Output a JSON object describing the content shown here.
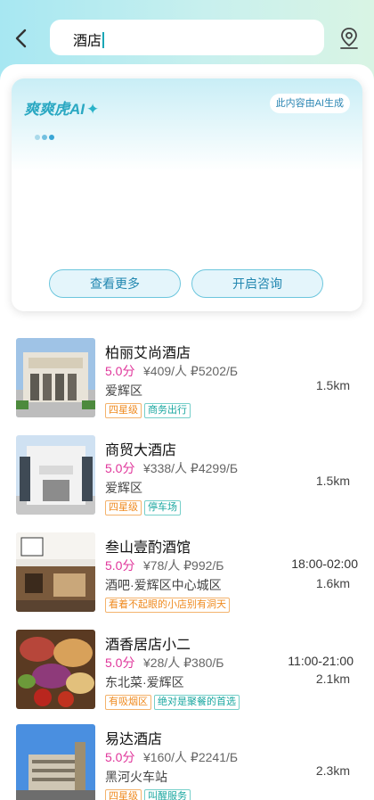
{
  "colors": {
    "accent": "#2aa8c2",
    "score": "#e0369b",
    "tag_orange": "#ef8a1f",
    "tag_teal": "#1aa7a0"
  },
  "header": {
    "search_value": "酒店",
    "back_icon": "chevron-left-icon",
    "location_icon": "location-pin-icon"
  },
  "ai": {
    "title": "爽爽虎AI",
    "spark": "✦",
    "badge": "此内容由AI生成",
    "more_button": "查看更多",
    "consult_button": "开启咨询"
  },
  "results": [
    {
      "name": "柏丽艾尚酒店",
      "score": "5.0分",
      "price": "¥409/人 ₽5202/Б",
      "area": "爱辉区",
      "hours": "",
      "distance": "1.5km",
      "tags": [
        {
          "text": "四星级",
          "color": "orange"
        },
        {
          "text": "商务出行",
          "color": "teal"
        }
      ]
    },
    {
      "name": "商贸大酒店",
      "score": "5.0分",
      "price": "¥338/人 ₽4299/Б",
      "area": "爱辉区",
      "hours": "",
      "distance": "1.5km",
      "tags": [
        {
          "text": "四星级",
          "color": "orange"
        },
        {
          "text": "停车场",
          "color": "teal"
        }
      ]
    },
    {
      "name": "叁山壹酌酒馆",
      "score": "5.0分",
      "price": "¥78/人 ₽992/Б",
      "area": "酒吧·爱辉区中心城区",
      "hours": "18:00-02:00",
      "distance": "1.6km",
      "tags": [
        {
          "text": "看着不起眼的小店别有洞天",
          "color": "orange"
        }
      ]
    },
    {
      "name": "酒香居店小二",
      "score": "5.0分",
      "price": "¥28/人 ₽380/Б",
      "area": "东北菜·爱辉区",
      "hours": "11:00-21:00",
      "distance": "2.1km",
      "tags": [
        {
          "text": "有吸烟区",
          "color": "orange"
        },
        {
          "text": "绝对是聚餐的首选",
          "color": "teal"
        }
      ]
    },
    {
      "name": "易达酒店",
      "score": "5.0分",
      "price": "¥160/人 ₽2241/Б",
      "area": "黑河火车站",
      "hours": "",
      "distance": "2.3km",
      "tags": [
        {
          "text": "四星级",
          "color": "orange"
        },
        {
          "text": "叫醒服务",
          "color": "teal"
        }
      ]
    }
  ]
}
